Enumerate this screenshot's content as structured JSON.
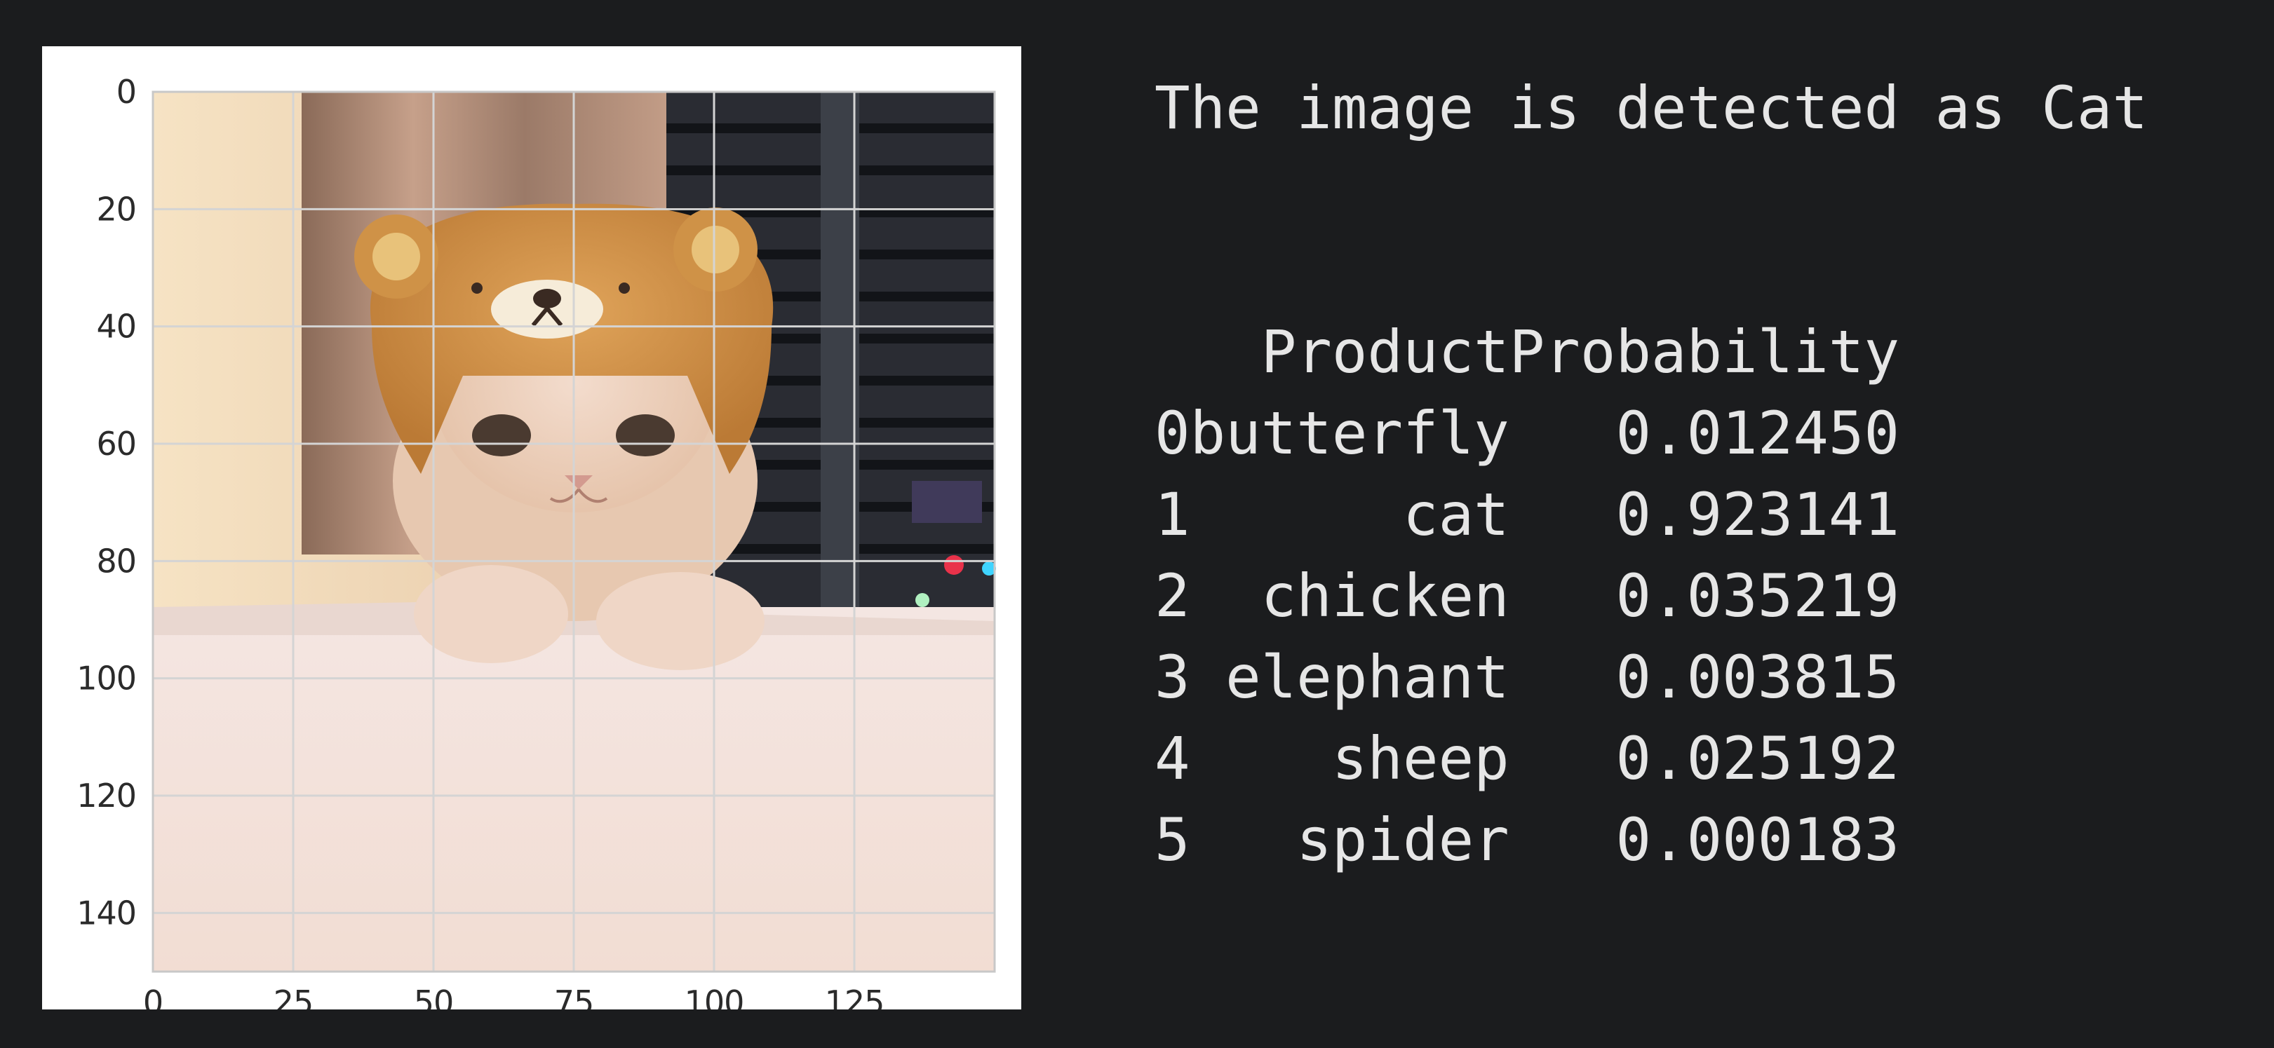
{
  "figure": {
    "image_description_icon": "cat-wearing-bear-hat-photo",
    "x_ticks": [
      "0",
      "25",
      "50",
      "75",
      "100",
      "125"
    ],
    "y_ticks": [
      "0",
      "20",
      "40",
      "60",
      "80",
      "100",
      "120",
      "140"
    ],
    "x_range": [
      0,
      150
    ],
    "y_range": [
      0,
      150
    ],
    "grid": true
  },
  "output": {
    "detected_text": "The image is detected as Cat",
    "table": {
      "headers": [
        "",
        "Product",
        "Probability"
      ],
      "rows": [
        {
          "index": "0",
          "product": "butterfly",
          "probability": "0.012450"
        },
        {
          "index": "1",
          "product": "cat",
          "probability": "0.923141"
        },
        {
          "index": "2",
          "product": "chicken",
          "probability": "0.035219"
        },
        {
          "index": "3",
          "product": "elephant",
          "probability": "0.003815"
        },
        {
          "index": "4",
          "product": "sheep",
          "probability": "0.025192"
        },
        {
          "index": "5",
          "product": "spider",
          "probability": "0.000183"
        }
      ]
    }
  },
  "colors": {
    "background": "#1b1c1e",
    "text": "#e6e6e6",
    "plot_panel": "#ffffff",
    "grid": "#d4d4d4"
  }
}
